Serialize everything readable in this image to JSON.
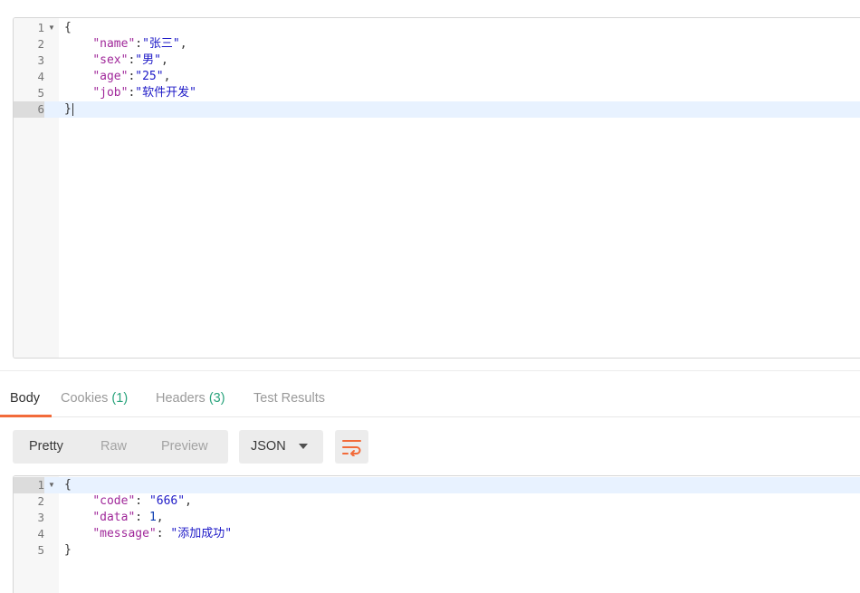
{
  "request_body": {
    "lines": [
      {
        "n": "1",
        "fold": true,
        "parts": [
          {
            "t": "{",
            "c": "punc"
          }
        ]
      },
      {
        "n": "2",
        "parts": [
          {
            "t": "    ",
            "c": "punc"
          },
          {
            "t": "\"name\"",
            "c": "key"
          },
          {
            "t": ":",
            "c": "punc"
          },
          {
            "t": "\"张三\"",
            "c": "str"
          },
          {
            "t": ",",
            "c": "punc"
          }
        ]
      },
      {
        "n": "3",
        "parts": [
          {
            "t": "    ",
            "c": "punc"
          },
          {
            "t": "\"sex\"",
            "c": "key"
          },
          {
            "t": ":",
            "c": "punc"
          },
          {
            "t": "\"男\"",
            "c": "str"
          },
          {
            "t": ",",
            "c": "punc"
          }
        ]
      },
      {
        "n": "4",
        "parts": [
          {
            "t": "    ",
            "c": "punc"
          },
          {
            "t": "\"age\"",
            "c": "key"
          },
          {
            "t": ":",
            "c": "punc"
          },
          {
            "t": "\"25\"",
            "c": "str"
          },
          {
            "t": ",",
            "c": "punc"
          }
        ]
      },
      {
        "n": "5",
        "parts": [
          {
            "t": "    ",
            "c": "punc"
          },
          {
            "t": "\"job\"",
            "c": "key"
          },
          {
            "t": ":",
            "c": "punc"
          },
          {
            "t": "\"软件开发\"",
            "c": "str"
          }
        ]
      },
      {
        "n": "6",
        "active": true,
        "cursor": true,
        "parts": [
          {
            "t": "}",
            "c": "punc"
          }
        ]
      }
    ]
  },
  "tabs": {
    "body": "Body",
    "cookies": "Cookies",
    "cookies_count": "(1)",
    "headers": "Headers",
    "headers_count": "(3)",
    "test_results": "Test Results"
  },
  "toolbar": {
    "pretty": "Pretty",
    "raw": "Raw",
    "preview": "Preview",
    "language": "JSON",
    "wrap_icon": "wrap-lines-icon"
  },
  "response_body": {
    "lines": [
      {
        "n": "1",
        "fold": true,
        "active": true,
        "parts": [
          {
            "t": "{",
            "c": "punc"
          }
        ]
      },
      {
        "n": "2",
        "parts": [
          {
            "t": "    ",
            "c": "punc"
          },
          {
            "t": "\"code\"",
            "c": "key"
          },
          {
            "t": ": ",
            "c": "punc"
          },
          {
            "t": "\"666\"",
            "c": "str"
          },
          {
            "t": ",",
            "c": "punc"
          }
        ]
      },
      {
        "n": "3",
        "parts": [
          {
            "t": "    ",
            "c": "punc"
          },
          {
            "t": "\"data\"",
            "c": "key"
          },
          {
            "t": ": ",
            "c": "punc"
          },
          {
            "t": "1",
            "c": "num"
          },
          {
            "t": ",",
            "c": "punc"
          }
        ]
      },
      {
        "n": "4",
        "parts": [
          {
            "t": "    ",
            "c": "punc"
          },
          {
            "t": "\"message\"",
            "c": "key"
          },
          {
            "t": ": ",
            "c": "punc"
          },
          {
            "t": "\"添加成功\"",
            "c": "str"
          }
        ]
      },
      {
        "n": "5",
        "parts": [
          {
            "t": "}",
            "c": "punc"
          }
        ]
      }
    ]
  },
  "colors": {
    "accent": "#f26b3a",
    "count": "#29a37c",
    "json_key": "#a0289a",
    "json_string": "#1d19c7",
    "json_number": "#0b3db0"
  }
}
